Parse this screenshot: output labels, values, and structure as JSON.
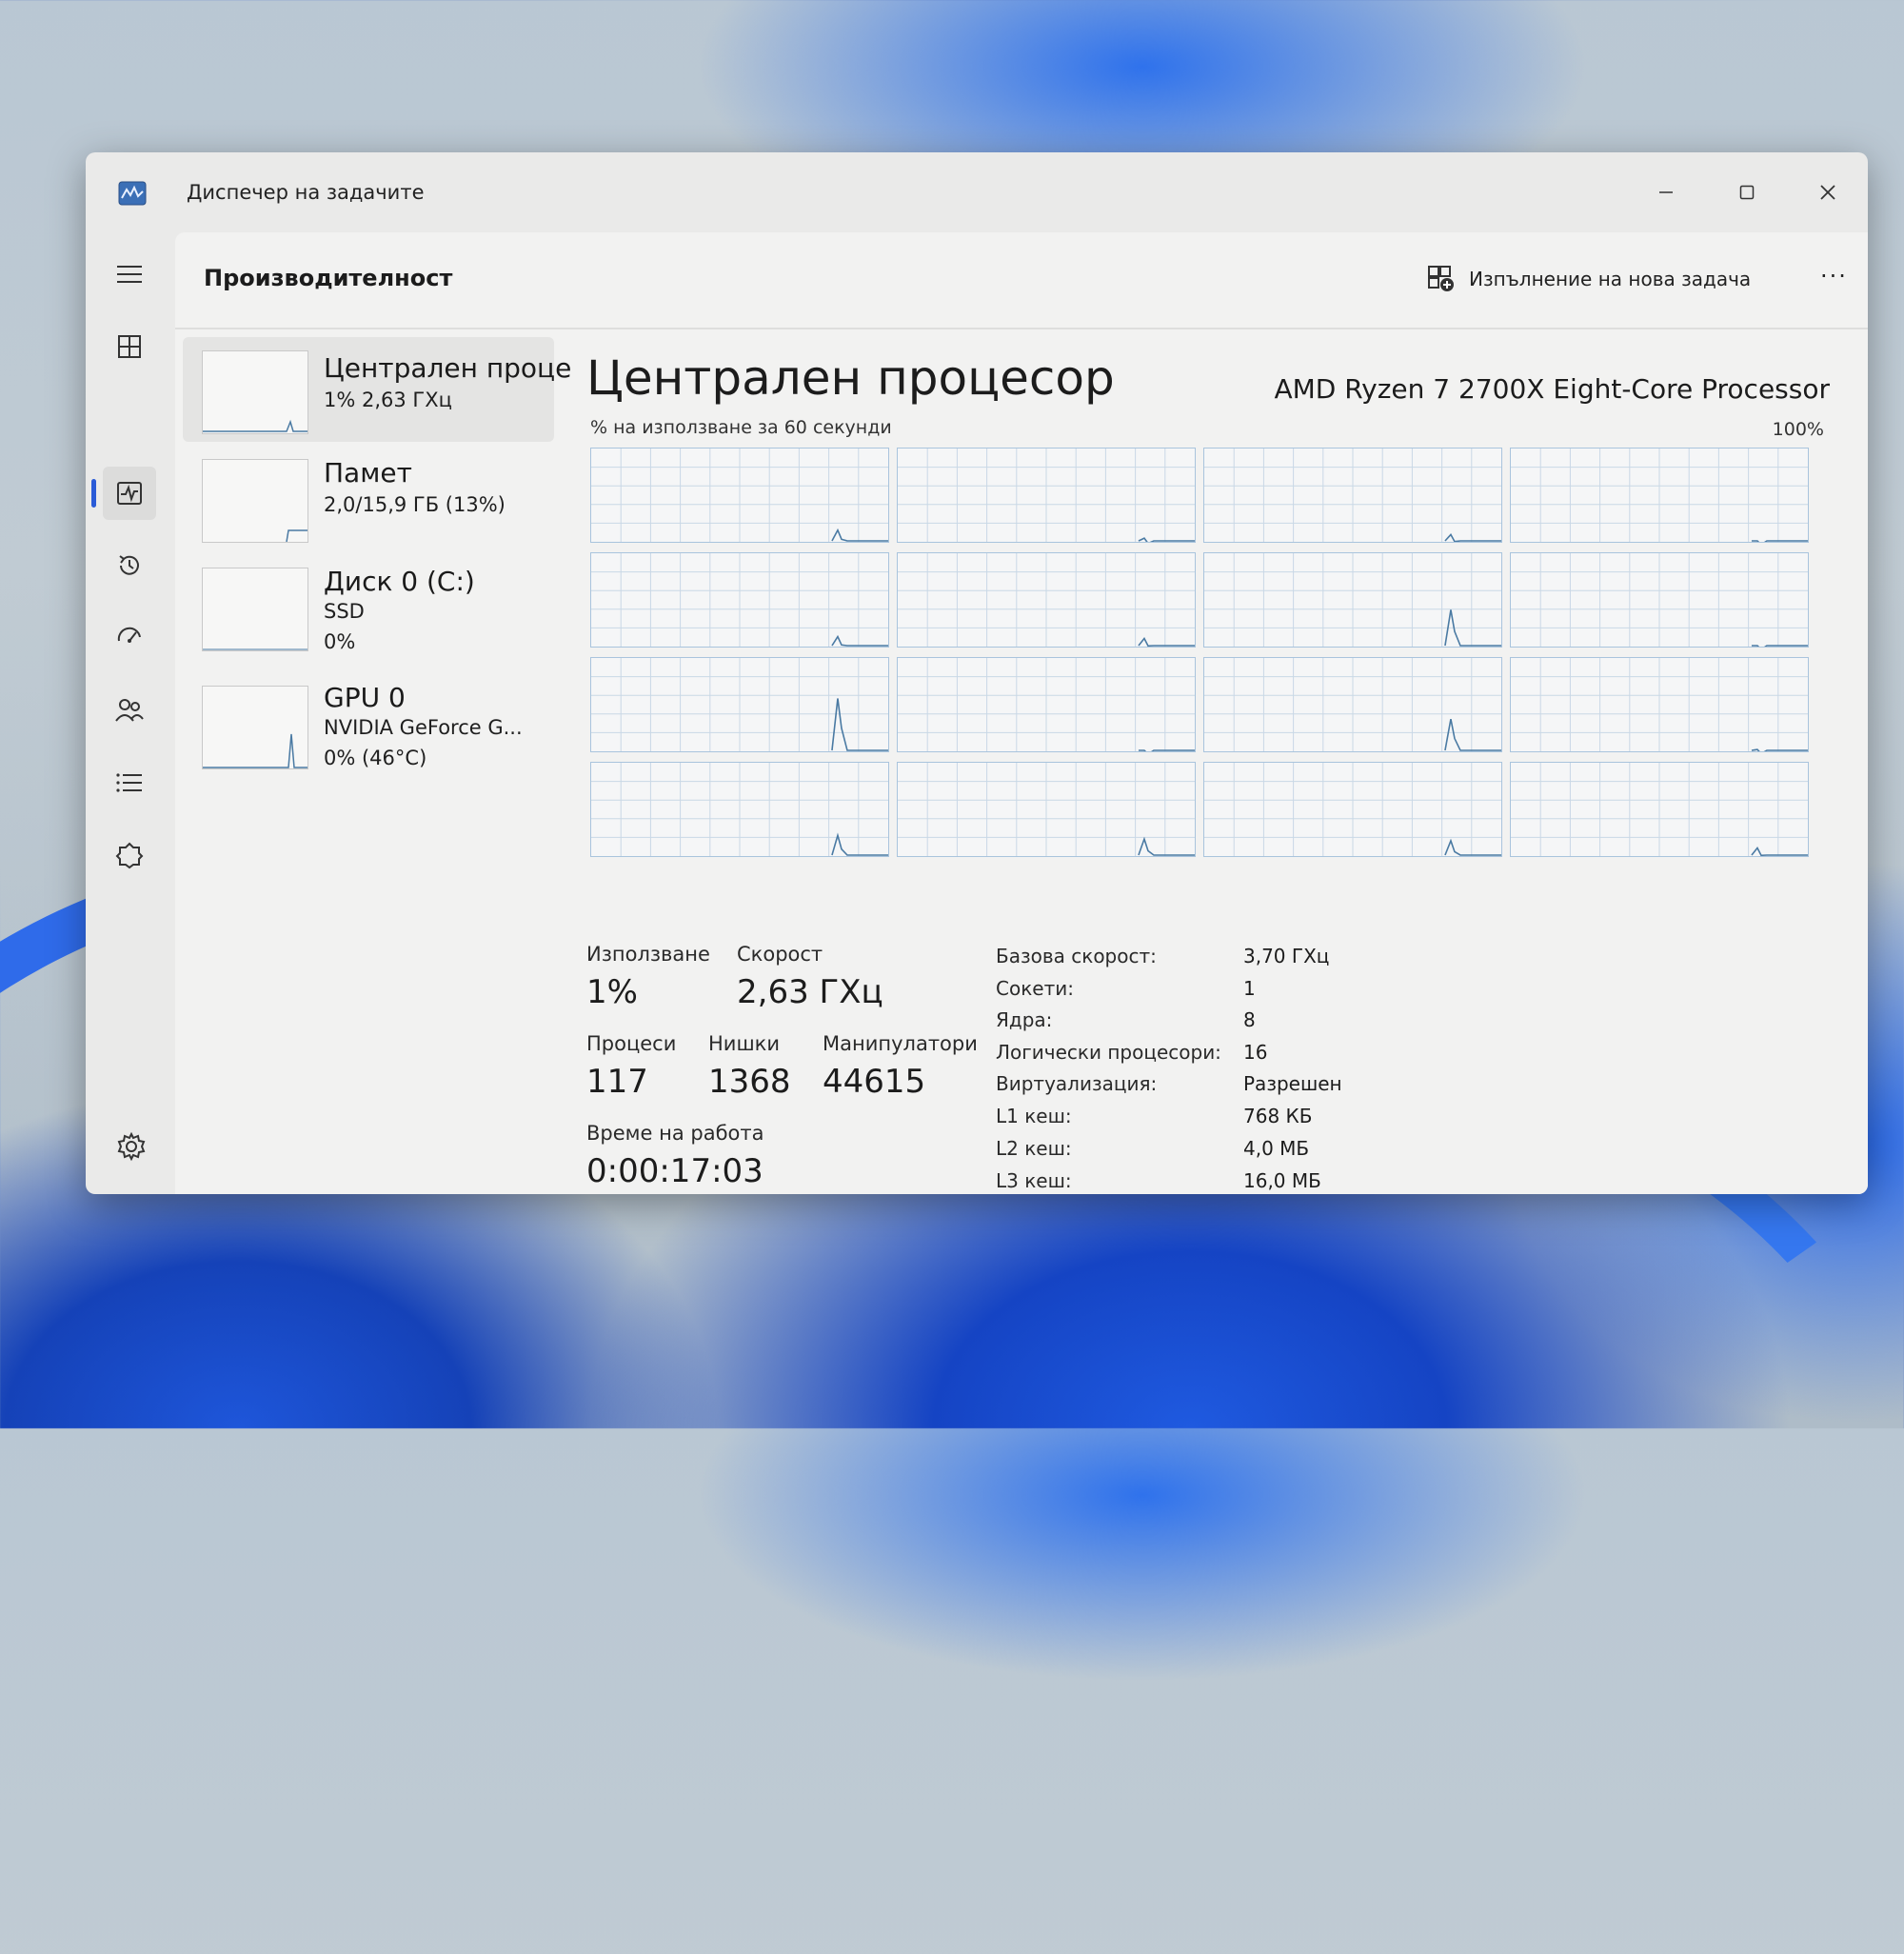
{
  "window": {
    "title": "Диспечер на задачите"
  },
  "header": {
    "page_title": "Производителност",
    "run_new_task": "Изпълнение на нова задача",
    "more": "···"
  },
  "resources": [
    {
      "name": "Централен проце",
      "line1": "1% 2,63 ГХц",
      "line2": "",
      "selected": true
    },
    {
      "name": "Памет",
      "line1": "2,0/15,9 ГБ (13%)",
      "line2": ""
    },
    {
      "name": "Диск 0 (C:)",
      "line1": "SSD",
      "line2": "0%"
    },
    {
      "name": "GPU 0",
      "line1": "NVIDIA GeForce G...",
      "line2": "0% (46°C)"
    }
  ],
  "cpu": {
    "title": "Централен процесор",
    "model": "AMD Ryzen 7 2700X Eight-Core Processor",
    "graph_caption": "% на използване за 60 секунди",
    "graph_max": "100%",
    "stats": {
      "usage_label": "Използване",
      "usage_value": "1%",
      "speed_label": "Скорост",
      "speed_value": "2,63 ГХц",
      "processes_label": "Процеси",
      "processes_value": "117",
      "threads_label": "Нишки",
      "threads_value": "1368",
      "handles_label": "Манипулатори",
      "handles_value": "44615",
      "uptime_label": "Време на работа",
      "uptime_value": "0:00:17:03"
    },
    "details": [
      {
        "key": "Базова скорост:",
        "value": "3,70 ГХц"
      },
      {
        "key": "Сокети:",
        "value": "1"
      },
      {
        "key": "Ядра:",
        "value": "8"
      },
      {
        "key": "Логически процесори:",
        "value": "16"
      },
      {
        "key": "Виртуализация:",
        "value": "Разрешен"
      },
      {
        "key": "L1 кеш:",
        "value": "768 КБ"
      },
      {
        "key": "L2 кеш:",
        "value": "4,0 МБ"
      },
      {
        "key": "L3 кеш:",
        "value": "16,0 МБ"
      }
    ],
    "core_usage_peaks_percent": [
      12,
      3,
      7,
      0,
      10,
      8,
      40,
      0,
      58,
      0,
      35,
      1,
      22,
      18,
      16,
      8
    ]
  },
  "colors": {
    "graph_line": "#4a7aa3",
    "grid_line": "#c9d8e6",
    "accent": "#2a5bd7"
  },
  "icons": [
    "app-icon",
    "hamburger-icon",
    "processes-icon",
    "performance-icon",
    "history-icon",
    "startup-icon",
    "users-icon",
    "details-icon",
    "services-icon",
    "settings-icon",
    "run-task-icon",
    "minimize-icon",
    "maximize-icon",
    "close-icon"
  ]
}
